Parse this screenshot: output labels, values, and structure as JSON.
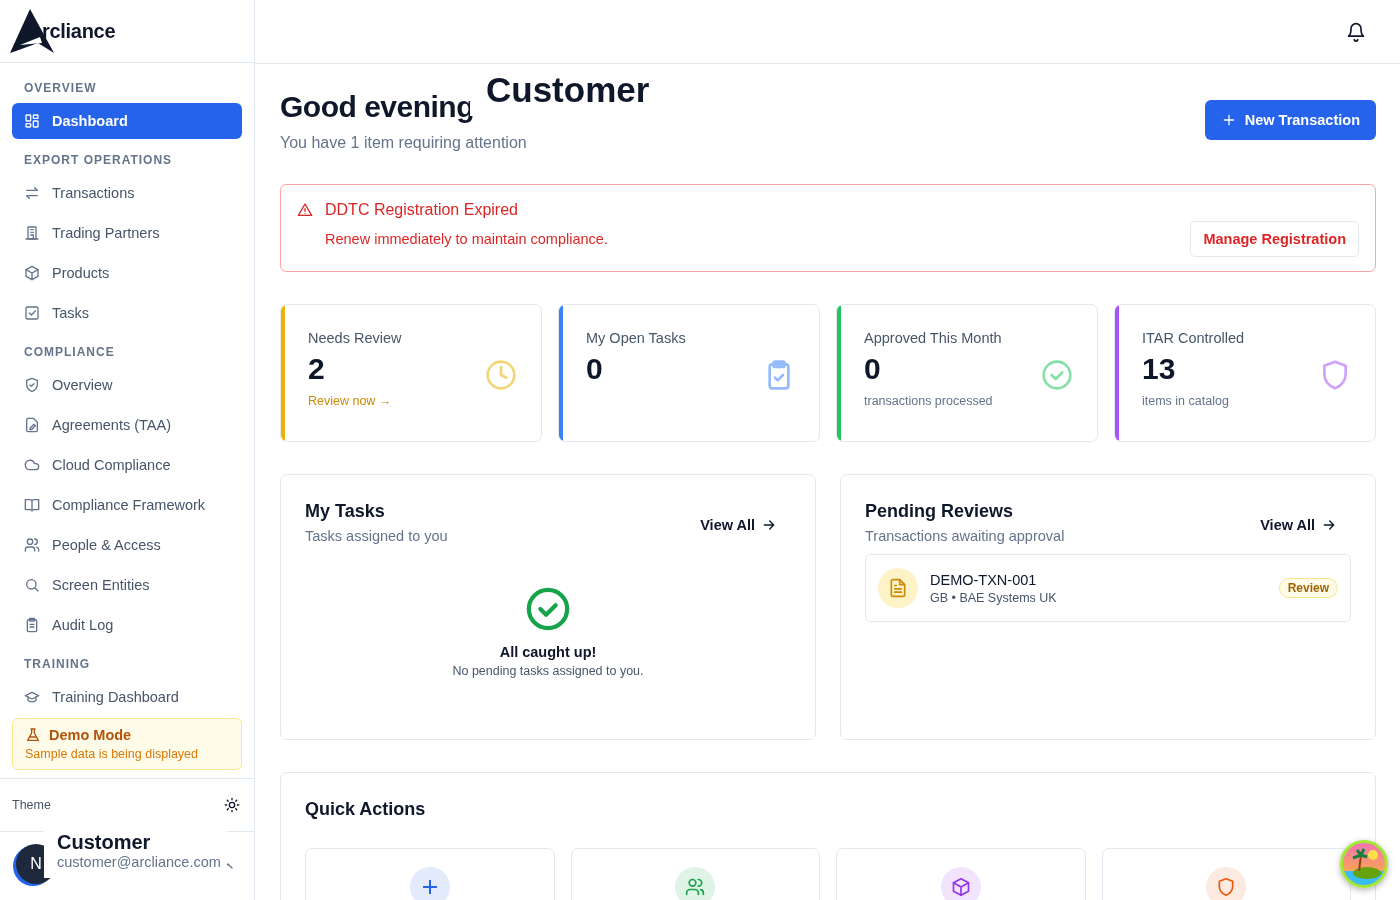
{
  "sidebar": {
    "logo": "rcliance",
    "sections": [
      {
        "title": "OVERVIEW",
        "items": [
          {
            "label": "Dashboard",
            "selected": true
          }
        ]
      },
      {
        "title": "EXPORT OPERATIONS",
        "items": [
          {
            "label": "Transactions",
            "selected": false
          },
          {
            "label": "Trading Partners",
            "selected": false
          },
          {
            "label": "Products",
            "selected": false
          },
          {
            "label": "Tasks",
            "selected": false
          }
        ]
      },
      {
        "title": "COMPLIANCE",
        "items": [
          {
            "label": "Overview",
            "selected": false
          },
          {
            "label": "Agreements (TAA)",
            "selected": false
          },
          {
            "label": "Cloud Compliance",
            "selected": false
          },
          {
            "label": "Compliance Framework",
            "selected": false
          },
          {
            "label": "People & Access",
            "selected": false
          },
          {
            "label": "Screen Entities",
            "selected": false
          },
          {
            "label": "Audit Log",
            "selected": false
          }
        ]
      },
      {
        "title": "TRAINING",
        "items": [
          {
            "label": "Training Dashboard",
            "selected": false
          }
        ]
      }
    ],
    "demo": {
      "title": "Demo Mode",
      "text": "Sample data is being displayed"
    },
    "theme_label": "Theme",
    "user": {
      "initial": "N",
      "name": "Customer",
      "email": "customer@arcliance.com"
    }
  },
  "header": {
    "greeting": "Good evening",
    "name_popup": "Customer",
    "subtitle": "You have 1 item requiring attention",
    "new_button": "New Transaction"
  },
  "alert": {
    "title": "DDTC Registration Expired",
    "text": "Renew immediately to maintain compliance.",
    "button": "Manage Registration"
  },
  "stats": [
    {
      "label": "Needs Review",
      "value": "2",
      "color": "#eab308",
      "link": "Review now →"
    },
    {
      "label": "My Open Tasks",
      "value": "0",
      "color": "#3b82f6"
    },
    {
      "label": "Approved This Month",
      "value": "0",
      "color": "#22c55e",
      "note": "transactions processed"
    },
    {
      "label": "ITAR Controlled",
      "value": "13",
      "color": "#a855f7",
      "note": "items in catalog"
    }
  ],
  "my_tasks": {
    "title": "My Tasks",
    "subtitle": "Tasks assigned to you",
    "view_all": "View All",
    "empty_title": "All caught up!",
    "empty_text": "No pending tasks assigned to you."
  },
  "pending_reviews": {
    "title": "Pending Reviews",
    "subtitle": "Transactions awaiting approval",
    "view_all": "View All",
    "items": [
      {
        "id": "DEMO-TXN-001",
        "meta": "GB • BAE Systems UK",
        "badge": "Review"
      }
    ]
  },
  "quick_actions": {
    "title": "Quick Actions",
    "items": [
      {
        "color": "#2563eb"
      },
      {
        "color": "#16a34a"
      },
      {
        "color": "#9333ea"
      },
      {
        "color": "#ea580c"
      }
    ]
  }
}
